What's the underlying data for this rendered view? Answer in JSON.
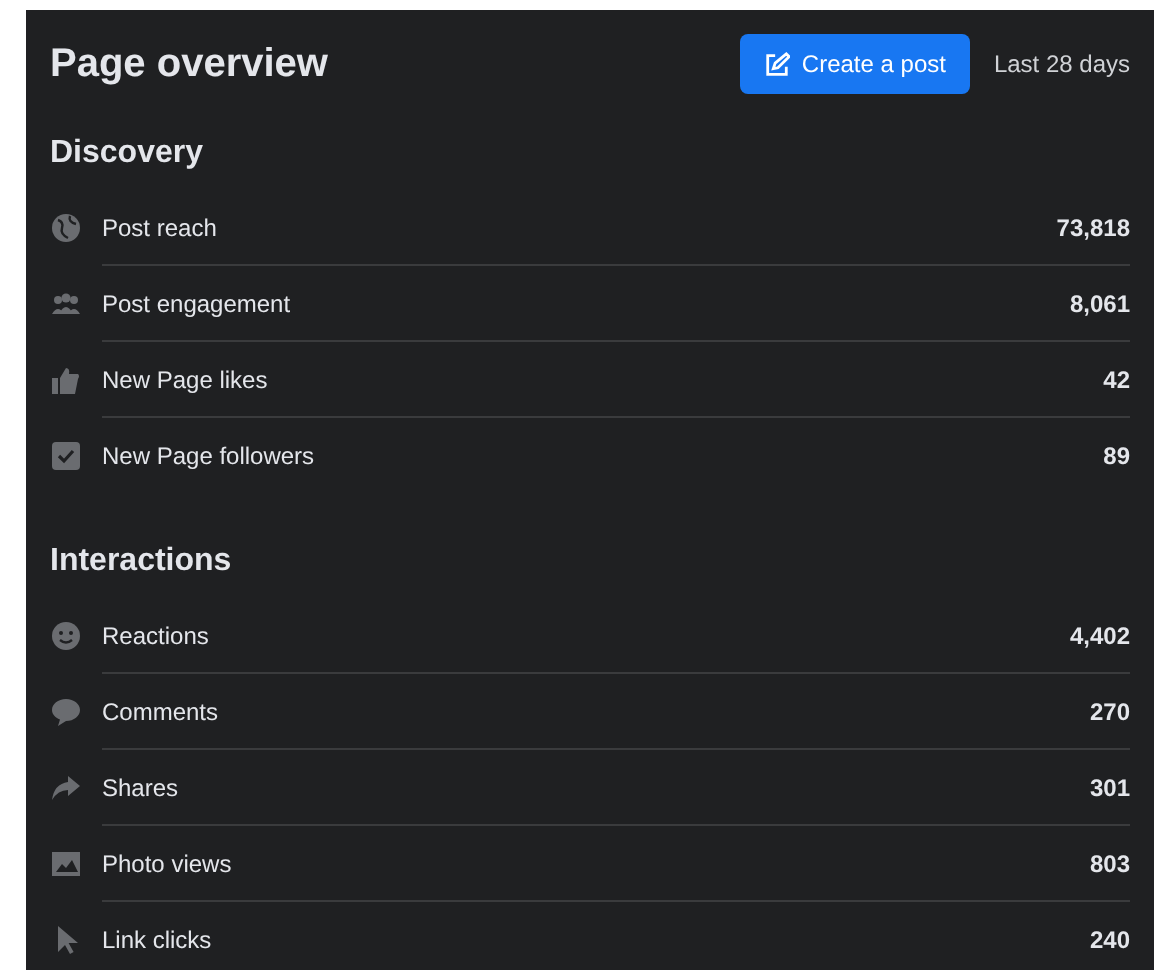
{
  "header": {
    "title": "Page overview",
    "create_button": "Create a post",
    "period": "Last 28 days"
  },
  "sections": [
    {
      "title": "Discovery",
      "metrics": [
        {
          "label": "Post reach",
          "value": "73,818"
        },
        {
          "label": "Post engagement",
          "value": "8,061"
        },
        {
          "label": "New Page likes",
          "value": "42"
        },
        {
          "label": "New Page followers",
          "value": "89"
        }
      ]
    },
    {
      "title": "Interactions",
      "metrics": [
        {
          "label": "Reactions",
          "value": "4,402"
        },
        {
          "label": "Comments",
          "value": "270"
        },
        {
          "label": "Shares",
          "value": "301"
        },
        {
          "label": "Photo views",
          "value": "803"
        },
        {
          "label": "Link clicks",
          "value": "240"
        }
      ]
    }
  ]
}
